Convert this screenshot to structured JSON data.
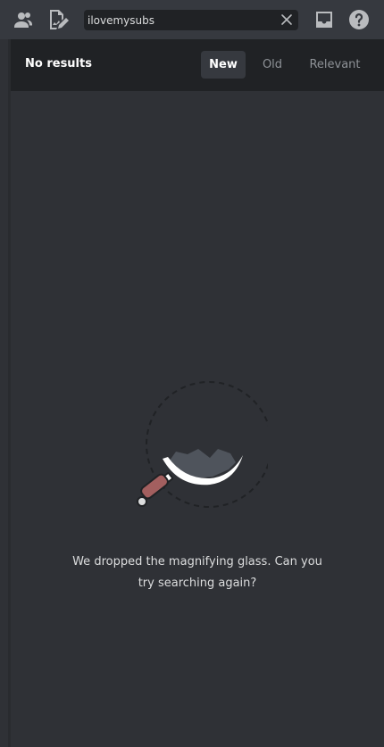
{
  "toolbar": {
    "members_icon": "members-icon",
    "edit_icon": "edit-document-icon",
    "inbox_icon": "inbox-icon",
    "help_icon": "help-icon"
  },
  "search": {
    "value": "ilovemysubs",
    "clear_icon": "close-icon"
  },
  "results": {
    "title": "No results",
    "sort_tabs": [
      {
        "label": "New",
        "active": true
      },
      {
        "label": "Old",
        "active": false
      },
      {
        "label": "Relevant",
        "active": false
      }
    ]
  },
  "empty_state": {
    "illustration": "dropped-magnifying-glass-icon",
    "message_line1": "We dropped the magnifying glass. Can you",
    "message_line2": "try searching again?"
  },
  "colors": {
    "background": "#36393f",
    "panel": "#2f3136",
    "header": "#202225",
    "text_primary": "#ffffff",
    "text_muted": "#8e9297",
    "accent_brown": "#a35f5f"
  }
}
